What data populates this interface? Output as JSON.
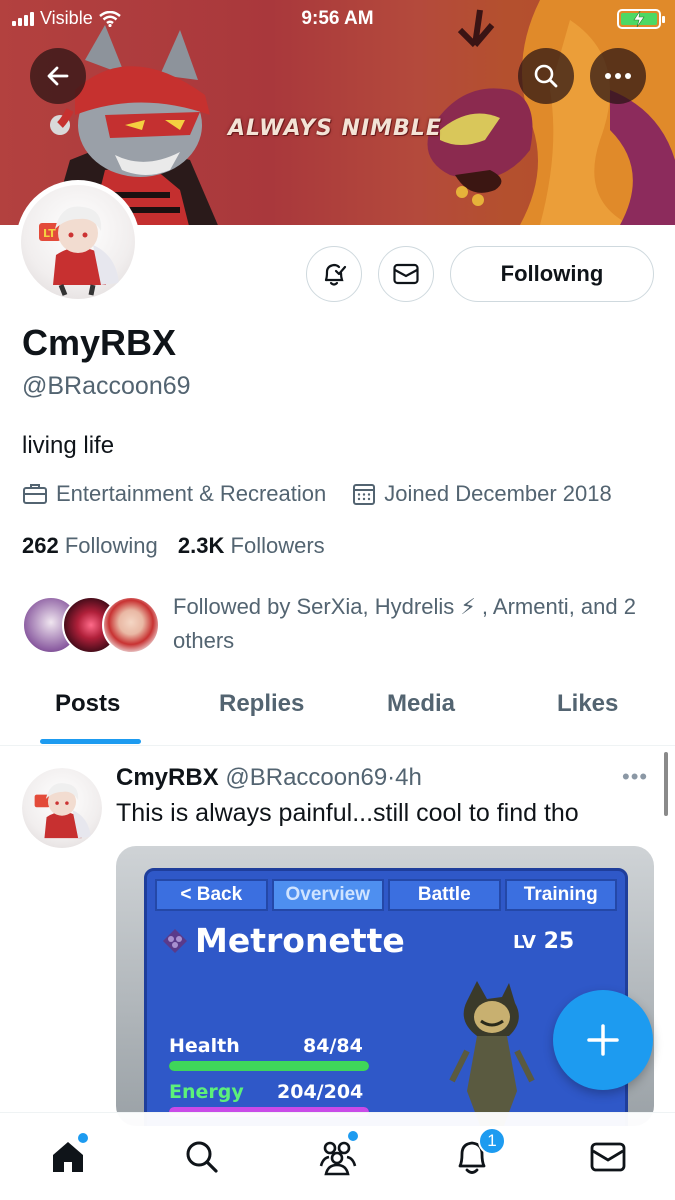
{
  "status_bar": {
    "carrier": "Visible",
    "time": "9:56 AM",
    "battery_color": "#4cd964"
  },
  "banner": {
    "motto": "ALWAYS NIMBLE",
    "bg_color": "#b3413f"
  },
  "header_actions": {
    "back_icon": "back-arrow-icon",
    "search_icon": "search-icon",
    "more_icon": "more-icon"
  },
  "profile": {
    "display_name": "CmyRBX",
    "handle": "@BRaccoon69",
    "bio": "living life",
    "category": "Entertainment & Recreation",
    "joined": "Joined December 2018",
    "following_count": "262",
    "following_label": "Following",
    "followers_count": "2.3K",
    "followers_label": "Followers",
    "followed_by": "Followed by SerXia, Hydrelis ⚡ , Armenti, and 2 others",
    "follow_button_label": "Following"
  },
  "tabs": [
    {
      "label": "Posts",
      "active": true
    },
    {
      "label": "Replies",
      "active": false
    },
    {
      "label": "Media",
      "active": false
    },
    {
      "label": "Likes",
      "active": false
    }
  ],
  "post": {
    "author_name": "CmyRBX",
    "author_handle": "@BRaccoon69",
    "separator": "·",
    "time": "4h",
    "text": "This is always painful...still cool to find tho",
    "more": "•••",
    "media": {
      "tabs": [
        "< Back",
        "Overview",
        "Battle",
        "Training"
      ],
      "active_tab": "Overview",
      "creature_name": "Metronette",
      "level_label": "LV",
      "level": "25",
      "stats": [
        {
          "label": "Health",
          "value": "84/84",
          "fraction": 1.0,
          "color": "#3fd65a",
          "label_color": "#ffffff"
        },
        {
          "label": "Energy",
          "value": "204/204",
          "fraction": 1.0,
          "color": "#c94ae8",
          "label_color": "#5cf07a"
        }
      ]
    }
  },
  "bottom_nav": {
    "notification_badge": "1",
    "accent_color": "#1d9bf0"
  }
}
